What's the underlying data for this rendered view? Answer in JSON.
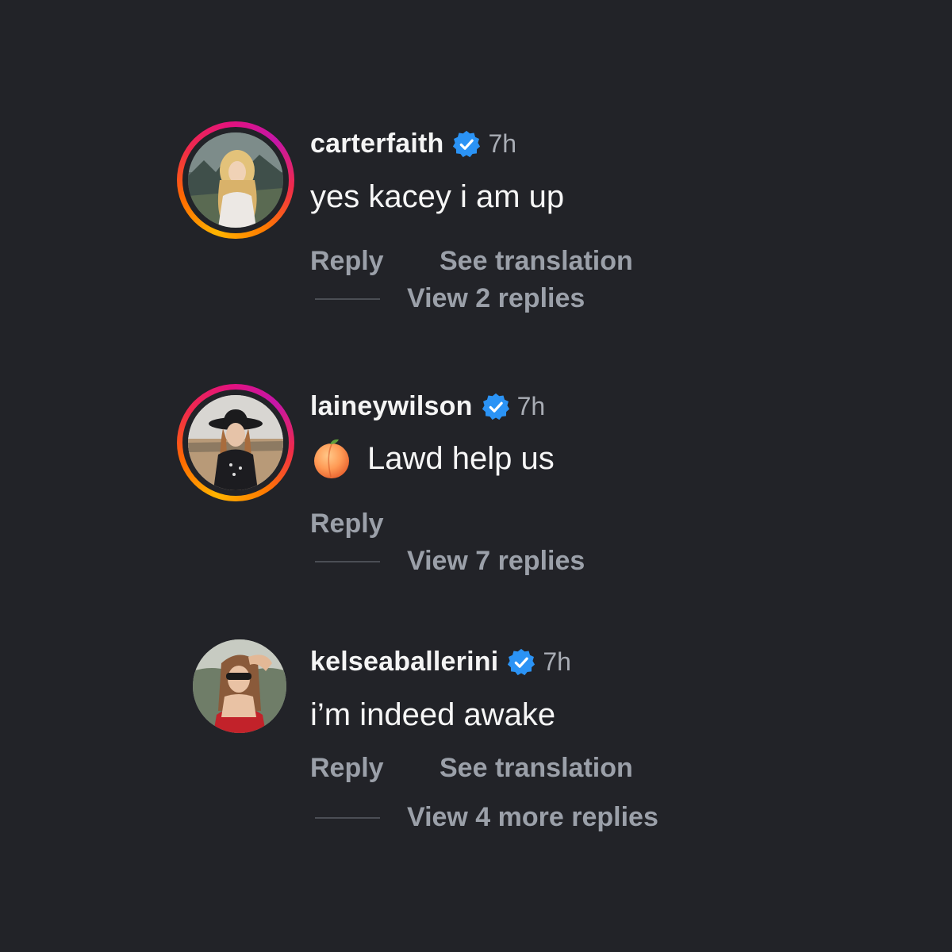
{
  "colors": {
    "background": "#222328",
    "verified_blue": "#2b93f5",
    "muted_text": "#9ba0a9"
  },
  "comments": [
    {
      "username": "carterfaith",
      "verified": true,
      "time": "7h",
      "text": "yes kacey i am up",
      "reply_label": "Reply",
      "translate_label": "See translation",
      "view_replies": "View 2 replies",
      "story_ring": true,
      "avatar_icon": "avatar-photo"
    },
    {
      "username": "laineywilson",
      "verified": true,
      "time": "7h",
      "emoji_icon": "peach-emoji-icon",
      "text": "Lawd help us",
      "reply_label": "Reply",
      "view_replies": "View 7 replies",
      "story_ring": true,
      "avatar_icon": "avatar-photo"
    },
    {
      "username": "kelseaballerini",
      "verified": true,
      "time": "7h",
      "text": "i’m indeed awake",
      "reply_label": "Reply",
      "translate_label": "See translation",
      "view_replies": "View 4 more replies",
      "story_ring": false,
      "avatar_icon": "avatar-photo"
    }
  ]
}
